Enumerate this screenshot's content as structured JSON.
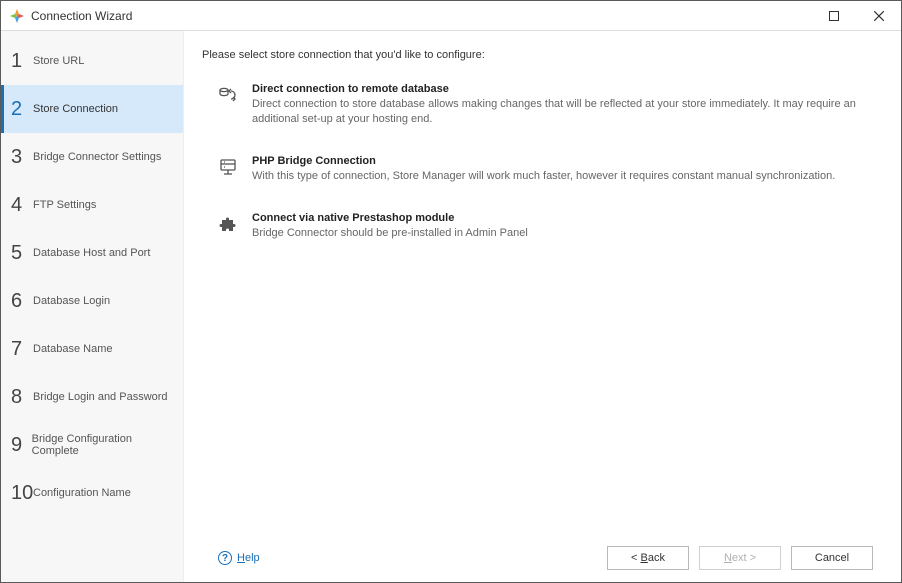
{
  "window": {
    "title": "Connection Wizard"
  },
  "sidebar": {
    "steps": [
      {
        "num": "1",
        "label": "Store URL"
      },
      {
        "num": "2",
        "label": "Store Connection"
      },
      {
        "num": "3",
        "label": "Bridge Connector Settings"
      },
      {
        "num": "4",
        "label": "FTP Settings"
      },
      {
        "num": "5",
        "label": "Database Host and Port"
      },
      {
        "num": "6",
        "label": "Database Login"
      },
      {
        "num": "7",
        "label": "Database Name"
      },
      {
        "num": "8",
        "label": "Bridge Login and Password"
      },
      {
        "num": "9",
        "label": "Bridge Configuration Complete"
      },
      {
        "num": "10",
        "label": "Configuration Name"
      }
    ],
    "activeIndex": 1
  },
  "content": {
    "prompt": "Please select store connection that you'd like to configure:",
    "options": [
      {
        "title": "Direct connection to remote database",
        "desc": "Direct connection to store database allows making changes that will be reflected at your store immediately. It may require an additional set-up at your hosting end."
      },
      {
        "title": "PHP Bridge Connection",
        "desc": "With this type of connection, Store Manager will work much faster, however it requires constant manual synchronization."
      },
      {
        "title": "Connect via native Prestashop module",
        "desc": "Bridge Connector should be pre-installed in Admin Panel"
      }
    ]
  },
  "footer": {
    "help": "Help",
    "back": "< Back",
    "next": "Next >",
    "cancel": "Cancel"
  }
}
